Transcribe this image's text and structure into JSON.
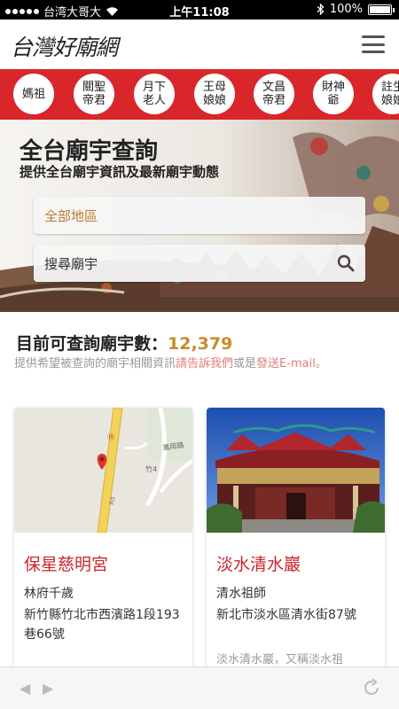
{
  "status": {
    "carrier": "台湾大哥大",
    "time": "上午11:08",
    "battery": "100%",
    "battery_level": 1.0
  },
  "header": {
    "logo": "台灣好廟網",
    "menu_icon": "hamburger-icon"
  },
  "deities": [
    "媽祖",
    "關聖帝君",
    "月下老人",
    "王母娘娘",
    "文昌帝君",
    "財神爺",
    "註生娘娘"
  ],
  "hero": {
    "title": "全台廟宇查詢",
    "subtitle": "提供全台廟宇資訊及最新廟宇動態",
    "region_value": "全部地區",
    "search_placeholder": "搜尋廟宇"
  },
  "count": {
    "label": "目前可查詢廟宇數：",
    "value": "12,379",
    "desc_prefix": "提供希望被查詢的廟宇相關資訊",
    "link_tell": "請告訴我們",
    "desc_mid": "或是",
    "link_email": "發送E-mail",
    "desc_end": "。"
  },
  "temples": [
    {
      "name": "保星慈明宮",
      "deity": "林府千歲",
      "address": "新竹縣竹北市西濱路1段193巷66號",
      "extra": "",
      "map_labels": [
        "竹4",
        "鳳岡路"
      ]
    },
    {
      "name": "淡水清水巖",
      "deity": "清水祖師",
      "address": "新北市淡水區清水街87號",
      "extra": "淡水清水巖，又稱淡水祖"
    }
  ],
  "colors": {
    "brand_red": "#d9262a",
    "count_gold": "#c98a2c",
    "title_red": "#c9252b",
    "link_pink": "#e07c7c"
  }
}
